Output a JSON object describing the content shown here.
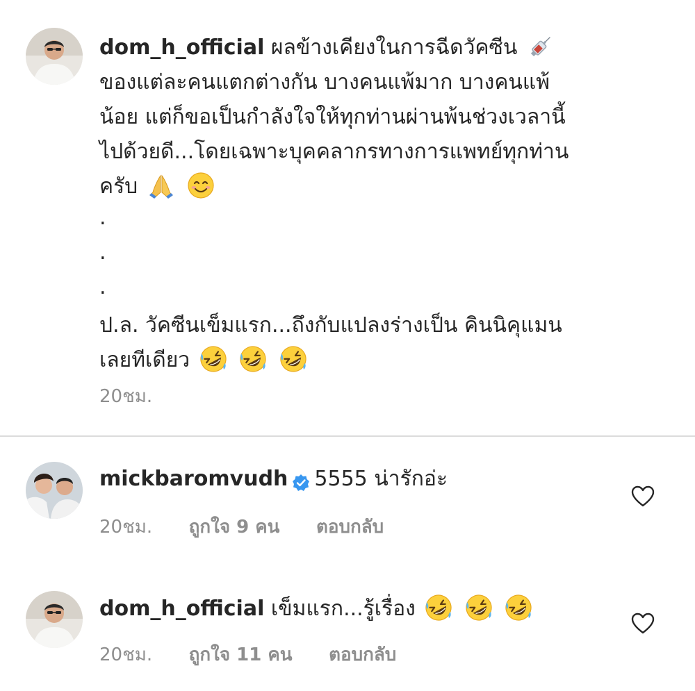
{
  "caption": {
    "username": "dom_h_official",
    "lines": [
      "ผลข้างเคียงในการฉีดวัคซีน",
      "ของแต่ละคนแตกต่างกัน บางคนแพ้มาก บางคนแพ้",
      "น้อย แต่ก็ขอเป็นกำลังใจให้ทุกท่านผ่านพ้นช่วงเวลานี้",
      "ไปด้วยดี...โดยเฉพาะบุคคลากรทางการแพทย์ทุกท่าน",
      "ครับ"
    ],
    "dots": [
      ".",
      ".",
      "."
    ],
    "ps_lines": [
      "ป.ล. วัคซีนเข็มแรก...ถึงกับแปลงร่างเป็น คินนิคุแมน",
      "เลยทีเดียว"
    ],
    "time": "20ชม.",
    "icons": {
      "syringe": "syringe-emoji",
      "pray": "folded-hands-emoji",
      "smile": "smiling-face-emoji",
      "laugh": "rolling-on-floor-laughing-emoji"
    }
  },
  "comments": [
    {
      "username": "mickbaromvudh",
      "verified": true,
      "text": "5555 น่ารักอ่ะ",
      "time": "20ชม.",
      "likes": "ถูกใจ 9 คน",
      "reply": "ตอบกลับ"
    },
    {
      "username": "dom_h_official",
      "verified": false,
      "text": "เข็มแรก...รู้เรื่อง",
      "time": "20ชม.",
      "likes": "ถูกใจ 11 คน",
      "reply": "ตอบกลับ"
    }
  ],
  "colors": {
    "text": "#262626",
    "meta": "#8e8e8e",
    "divider": "#dbdbdb",
    "verified": "#3897f0"
  }
}
